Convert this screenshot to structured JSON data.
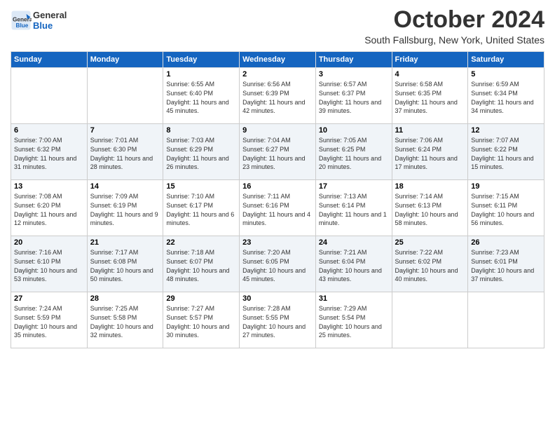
{
  "header": {
    "logo_line1": "General",
    "logo_line2": "Blue",
    "month": "October 2024",
    "location": "South Fallsburg, New York, United States"
  },
  "weekdays": [
    "Sunday",
    "Monday",
    "Tuesday",
    "Wednesday",
    "Thursday",
    "Friday",
    "Saturday"
  ],
  "weeks": [
    [
      {
        "day": "",
        "info": ""
      },
      {
        "day": "",
        "info": ""
      },
      {
        "day": "1",
        "info": "Sunrise: 6:55 AM\nSunset: 6:40 PM\nDaylight: 11 hours and 45 minutes."
      },
      {
        "day": "2",
        "info": "Sunrise: 6:56 AM\nSunset: 6:39 PM\nDaylight: 11 hours and 42 minutes."
      },
      {
        "day": "3",
        "info": "Sunrise: 6:57 AM\nSunset: 6:37 PM\nDaylight: 11 hours and 39 minutes."
      },
      {
        "day": "4",
        "info": "Sunrise: 6:58 AM\nSunset: 6:35 PM\nDaylight: 11 hours and 37 minutes."
      },
      {
        "day": "5",
        "info": "Sunrise: 6:59 AM\nSunset: 6:34 PM\nDaylight: 11 hours and 34 minutes."
      }
    ],
    [
      {
        "day": "6",
        "info": "Sunrise: 7:00 AM\nSunset: 6:32 PM\nDaylight: 11 hours and 31 minutes."
      },
      {
        "day": "7",
        "info": "Sunrise: 7:01 AM\nSunset: 6:30 PM\nDaylight: 11 hours and 28 minutes."
      },
      {
        "day": "8",
        "info": "Sunrise: 7:03 AM\nSunset: 6:29 PM\nDaylight: 11 hours and 26 minutes."
      },
      {
        "day": "9",
        "info": "Sunrise: 7:04 AM\nSunset: 6:27 PM\nDaylight: 11 hours and 23 minutes."
      },
      {
        "day": "10",
        "info": "Sunrise: 7:05 AM\nSunset: 6:25 PM\nDaylight: 11 hours and 20 minutes."
      },
      {
        "day": "11",
        "info": "Sunrise: 7:06 AM\nSunset: 6:24 PM\nDaylight: 11 hours and 17 minutes."
      },
      {
        "day": "12",
        "info": "Sunrise: 7:07 AM\nSunset: 6:22 PM\nDaylight: 11 hours and 15 minutes."
      }
    ],
    [
      {
        "day": "13",
        "info": "Sunrise: 7:08 AM\nSunset: 6:20 PM\nDaylight: 11 hours and 12 minutes."
      },
      {
        "day": "14",
        "info": "Sunrise: 7:09 AM\nSunset: 6:19 PM\nDaylight: 11 hours and 9 minutes."
      },
      {
        "day": "15",
        "info": "Sunrise: 7:10 AM\nSunset: 6:17 PM\nDaylight: 11 hours and 6 minutes."
      },
      {
        "day": "16",
        "info": "Sunrise: 7:11 AM\nSunset: 6:16 PM\nDaylight: 11 hours and 4 minutes."
      },
      {
        "day": "17",
        "info": "Sunrise: 7:13 AM\nSunset: 6:14 PM\nDaylight: 11 hours and 1 minute."
      },
      {
        "day": "18",
        "info": "Sunrise: 7:14 AM\nSunset: 6:13 PM\nDaylight: 10 hours and 58 minutes."
      },
      {
        "day": "19",
        "info": "Sunrise: 7:15 AM\nSunset: 6:11 PM\nDaylight: 10 hours and 56 minutes."
      }
    ],
    [
      {
        "day": "20",
        "info": "Sunrise: 7:16 AM\nSunset: 6:10 PM\nDaylight: 10 hours and 53 minutes."
      },
      {
        "day": "21",
        "info": "Sunrise: 7:17 AM\nSunset: 6:08 PM\nDaylight: 10 hours and 50 minutes."
      },
      {
        "day": "22",
        "info": "Sunrise: 7:18 AM\nSunset: 6:07 PM\nDaylight: 10 hours and 48 minutes."
      },
      {
        "day": "23",
        "info": "Sunrise: 7:20 AM\nSunset: 6:05 PM\nDaylight: 10 hours and 45 minutes."
      },
      {
        "day": "24",
        "info": "Sunrise: 7:21 AM\nSunset: 6:04 PM\nDaylight: 10 hours and 43 minutes."
      },
      {
        "day": "25",
        "info": "Sunrise: 7:22 AM\nSunset: 6:02 PM\nDaylight: 10 hours and 40 minutes."
      },
      {
        "day": "26",
        "info": "Sunrise: 7:23 AM\nSunset: 6:01 PM\nDaylight: 10 hours and 37 minutes."
      }
    ],
    [
      {
        "day": "27",
        "info": "Sunrise: 7:24 AM\nSunset: 5:59 PM\nDaylight: 10 hours and 35 minutes."
      },
      {
        "day": "28",
        "info": "Sunrise: 7:25 AM\nSunset: 5:58 PM\nDaylight: 10 hours and 32 minutes."
      },
      {
        "day": "29",
        "info": "Sunrise: 7:27 AM\nSunset: 5:57 PM\nDaylight: 10 hours and 30 minutes."
      },
      {
        "day": "30",
        "info": "Sunrise: 7:28 AM\nSunset: 5:55 PM\nDaylight: 10 hours and 27 minutes."
      },
      {
        "day": "31",
        "info": "Sunrise: 7:29 AM\nSunset: 5:54 PM\nDaylight: 10 hours and 25 minutes."
      },
      {
        "day": "",
        "info": ""
      },
      {
        "day": "",
        "info": ""
      }
    ]
  ]
}
